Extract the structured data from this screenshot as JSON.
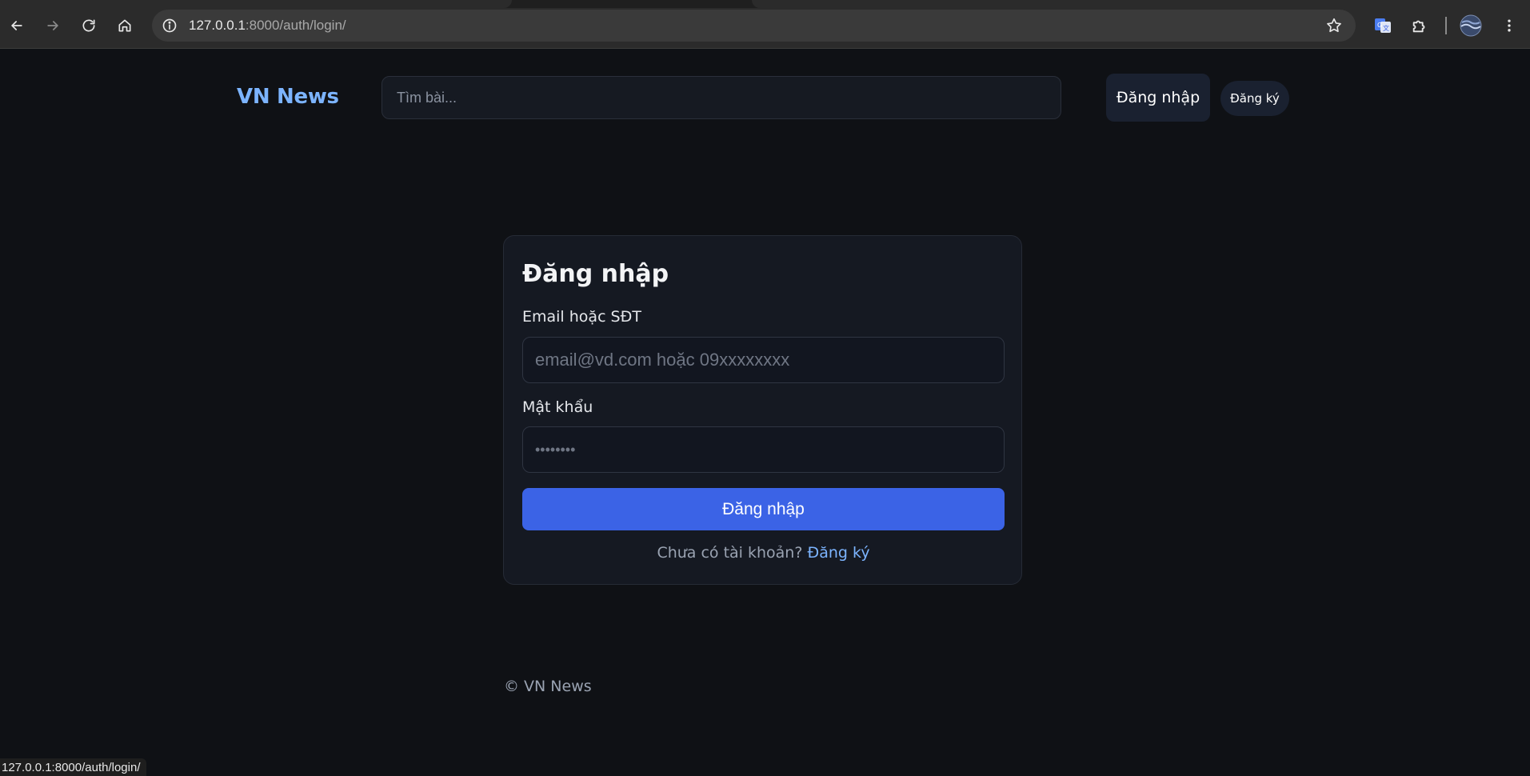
{
  "browser": {
    "url_host": "127.0.0.1",
    "url_rest": ":8000/auth/login/",
    "status_url": "127.0.0.1:8000/auth/login/"
  },
  "header": {
    "logo": "VN News",
    "search_placeholder": "Tìm bài...",
    "login_label": "Đăng nhập",
    "register_label": "Đăng ký"
  },
  "login_card": {
    "title": "Đăng nhập",
    "email_label": "Email hoặc SĐT",
    "email_placeholder": "email@vd.com hoặc 09xxxxxxxx",
    "password_label": "Mật khẩu",
    "password_placeholder": "••••••••",
    "submit_label": "Đăng nhập",
    "no_account_text": "Chưa có tài khoản?",
    "register_link": "Đăng ký"
  },
  "footer": {
    "text": "© VN News"
  },
  "colors": {
    "accent": "#3b63e6",
    "link": "#7cb4ff",
    "background": "#0f1115"
  }
}
